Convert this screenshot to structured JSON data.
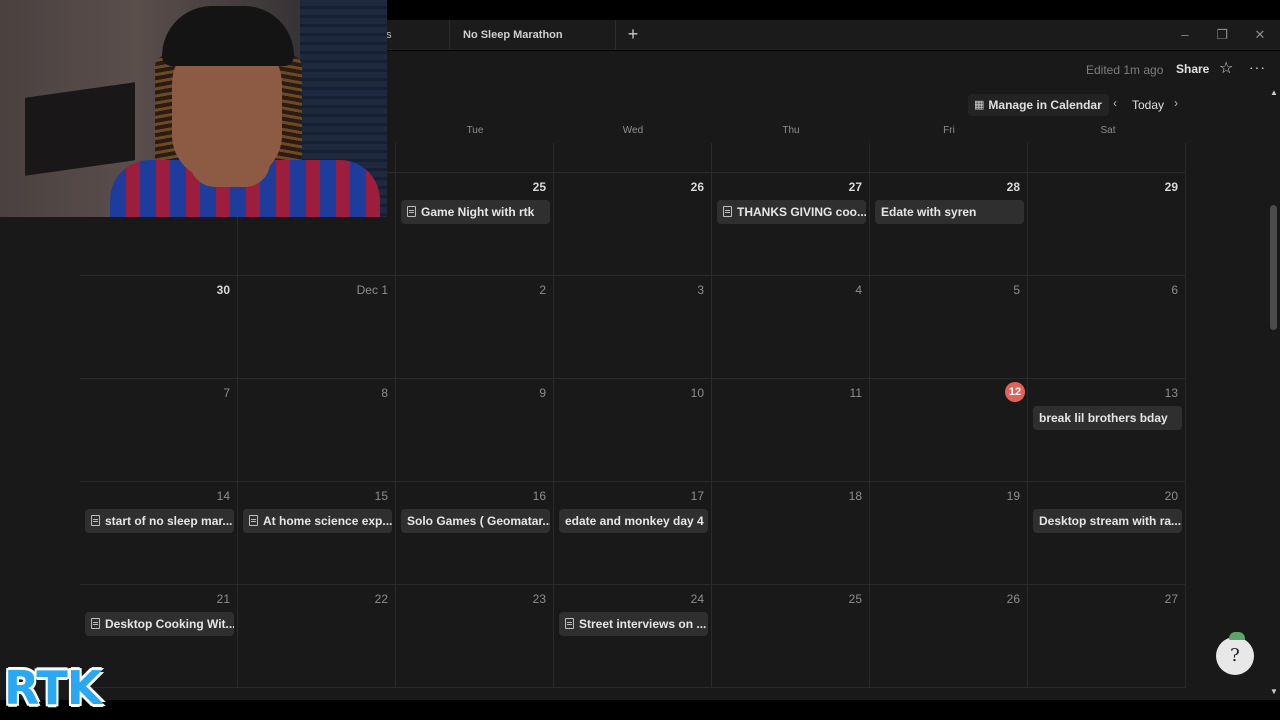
{
  "tabs": [
    {
      "label": "ns"
    },
    {
      "label": "No Sleep Marathon"
    }
  ],
  "tab_add_label": "+",
  "window_controls": {
    "minimize": "–",
    "maximize": "❐",
    "close": "✕"
  },
  "header": {
    "edited": "Edited 1m ago",
    "share": "Share",
    "favorite_icon": "☆",
    "more_icon": "···"
  },
  "calendar_toolbar": {
    "manage": "Manage in Calendar",
    "calendar_icon": "▦",
    "prev_icon": "‹",
    "today": "Today",
    "next_icon": "›"
  },
  "weekdays": [
    "Tue",
    "Wed",
    "Thu",
    "Fri",
    "Sat"
  ],
  "weeks": [
    {
      "days": [
        {
          "num": "",
          "bold": false
        },
        {
          "num": "",
          "bold": false
        },
        {
          "num": "",
          "bold": false
        },
        {
          "num": "",
          "bold": false
        },
        {
          "num": "",
          "bold": false
        },
        {
          "num": "",
          "bold": false
        },
        {
          "num": "",
          "bold": false
        }
      ]
    },
    {
      "days": [
        {
          "num": "",
          "bold": true
        },
        {
          "num": "",
          "bold": true
        },
        {
          "num": "25",
          "bold": true,
          "event": "Game Night with rtk",
          "doc": true
        },
        {
          "num": "26",
          "bold": true
        },
        {
          "num": "27",
          "bold": true,
          "event": "THANKS GIVING coo...",
          "doc": true
        },
        {
          "num": "28",
          "bold": true,
          "event": "Edate with syren",
          "doc": false
        },
        {
          "num": "29",
          "bold": true
        }
      ]
    },
    {
      "days": [
        {
          "num": "30",
          "bold": true
        },
        {
          "num": "Dec 1"
        },
        {
          "num": "2"
        },
        {
          "num": "3"
        },
        {
          "num": "4"
        },
        {
          "num": "5"
        },
        {
          "num": "6"
        }
      ]
    },
    {
      "days": [
        {
          "num": "7"
        },
        {
          "num": "8"
        },
        {
          "num": "9"
        },
        {
          "num": "10"
        },
        {
          "num": "11"
        },
        {
          "num": "12",
          "today": true
        },
        {
          "num": "13",
          "event": "break lil brothers bday",
          "doc": false
        }
      ]
    },
    {
      "days": [
        {
          "num": "14",
          "event": "start of no sleep mar...",
          "doc": true
        },
        {
          "num": "15",
          "event": "At home science exp...",
          "doc": true
        },
        {
          "num": "16",
          "event": "Solo Games ( Geomatar...",
          "doc": false
        },
        {
          "num": "17",
          "event": "edate and monkey day 4",
          "doc": false
        },
        {
          "num": "18"
        },
        {
          "num": "19"
        },
        {
          "num": "20",
          "event": "Desktop stream with ra...",
          "doc": false
        }
      ]
    },
    {
      "days": [
        {
          "num": "21",
          "event": "Desktop Cooking Wit...",
          "doc": true
        },
        {
          "num": "22"
        },
        {
          "num": "23"
        },
        {
          "num": "24",
          "event": "Street interviews on ...",
          "doc": true
        },
        {
          "num": "25"
        },
        {
          "num": "26"
        },
        {
          "num": "27"
        }
      ]
    }
  ],
  "help_icon": "?",
  "webcam_overlay": {
    "icon": "webcam-feed"
  },
  "logo": {
    "text": "RTK"
  }
}
